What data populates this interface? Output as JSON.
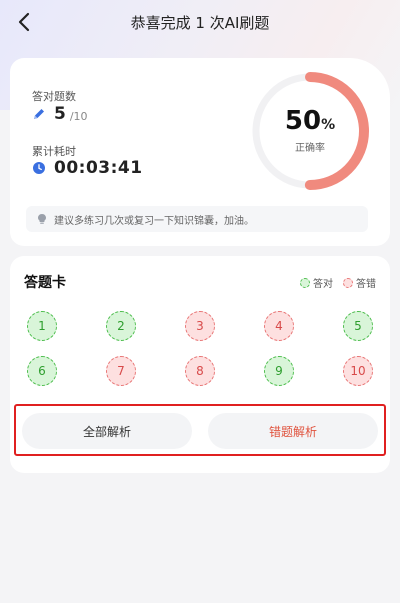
{
  "header": {
    "title": "恭喜完成 1 次AI刷题"
  },
  "stats": {
    "count_label": "答对题数",
    "count_value": "5",
    "count_total": "/10",
    "time_label": "累计耗时",
    "time_value": "00:03:41",
    "accuracy_percent": 50,
    "accuracy_number": "50",
    "accuracy_sign": "%",
    "accuracy_label": "正确率",
    "tip": "建议多练习几次或复习一下知识锦囊，加油。"
  },
  "answer_card": {
    "title": "答题卡",
    "legend_correct": "答对",
    "legend_wrong": "答错",
    "questions": [
      {
        "num": "1",
        "status": "correct"
      },
      {
        "num": "2",
        "status": "correct"
      },
      {
        "num": "3",
        "status": "wrong"
      },
      {
        "num": "4",
        "status": "wrong"
      },
      {
        "num": "5",
        "status": "correct"
      },
      {
        "num": "6",
        "status": "correct"
      },
      {
        "num": "7",
        "status": "wrong"
      },
      {
        "num": "8",
        "status": "wrong"
      },
      {
        "num": "9",
        "status": "correct"
      },
      {
        "num": "10",
        "status": "wrong"
      }
    ],
    "btn_all": "全部解析",
    "btn_wrong": "错题解析"
  },
  "colors": {
    "ring_progress": "#f08a7e",
    "ring_track": "#f1f1f3",
    "correct": "#4cbd4c",
    "wrong": "#e87474",
    "accent_wrong_text": "#e0533e",
    "icon_blue": "#3a6fe0"
  },
  "icons": {
    "back": "chevron-left-icon",
    "count": "pencil-icon",
    "time": "clock-icon",
    "tip": "bulb-icon"
  }
}
